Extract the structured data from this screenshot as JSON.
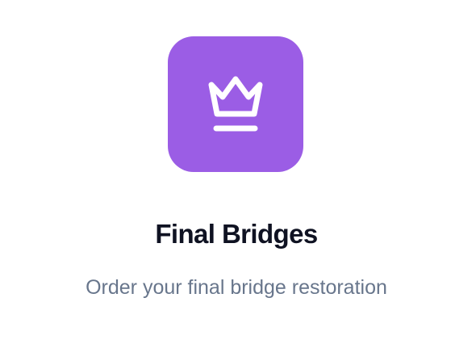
{
  "header": {
    "icon": "crown-icon",
    "title": "Final Bridges",
    "subtitle": "Order your final bridge restoration"
  },
  "colors": {
    "icon_background": "#9b5de5",
    "icon_foreground": "#ffffff",
    "title": "#0f1222",
    "subtitle": "#68768c",
    "background": "#ffffff"
  }
}
